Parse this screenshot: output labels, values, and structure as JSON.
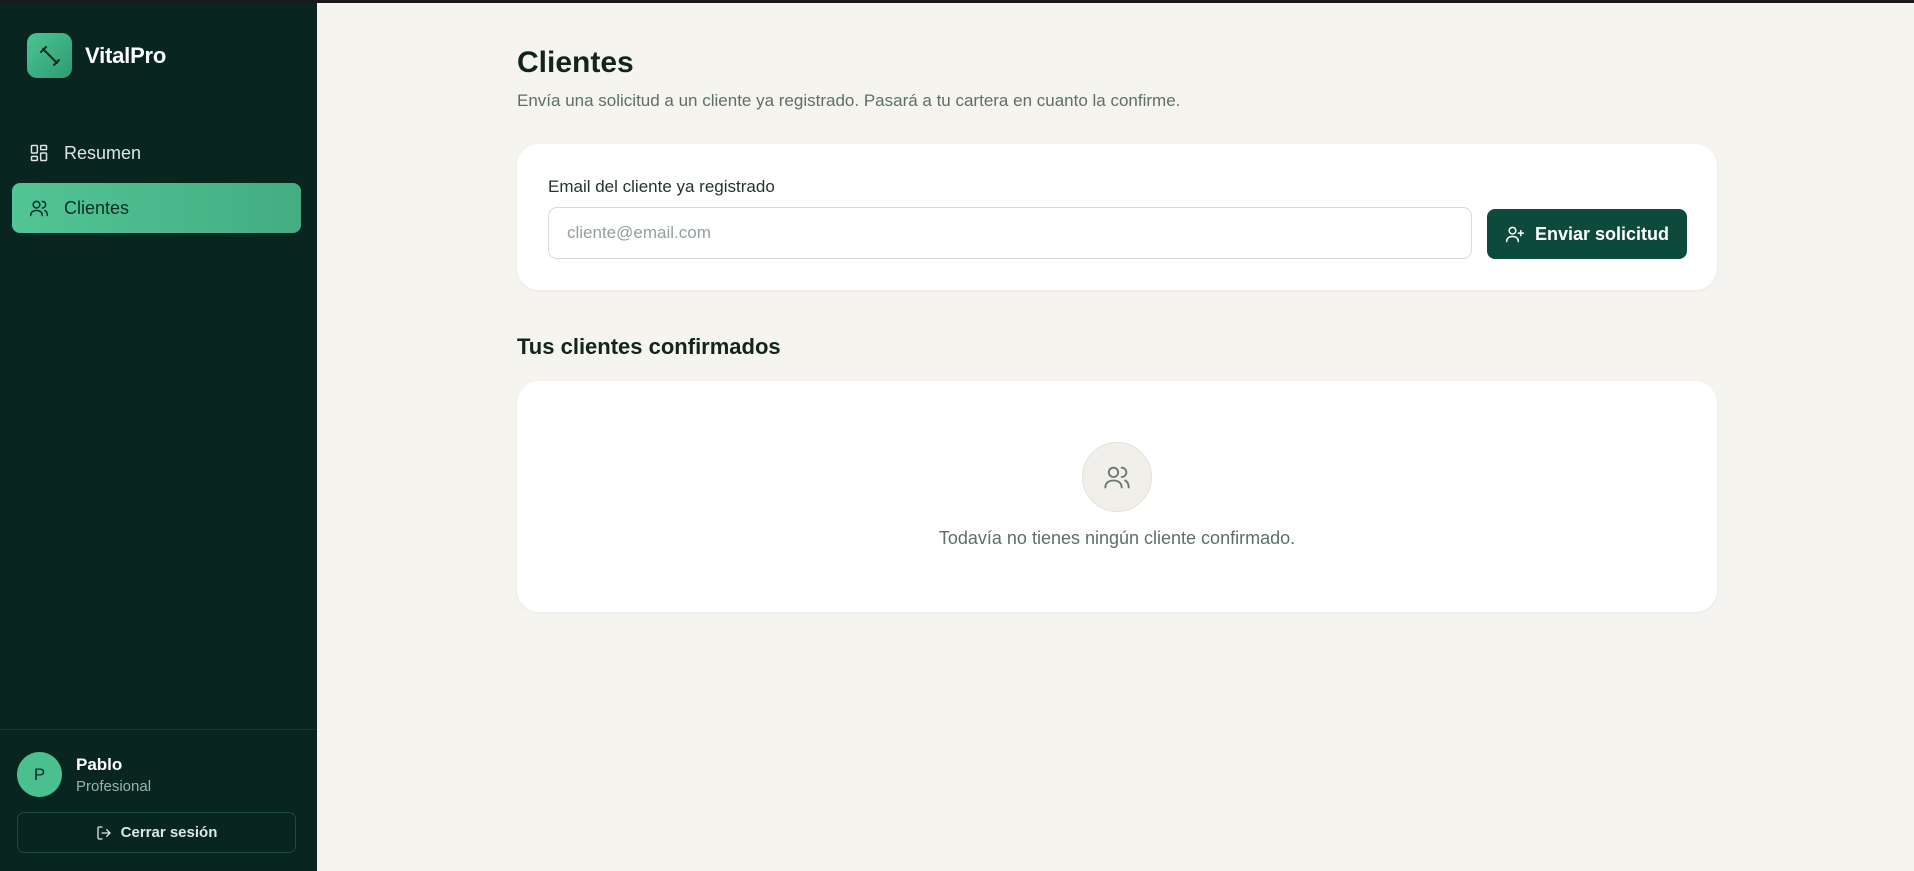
{
  "app": {
    "name": "VitalPro"
  },
  "sidebar": {
    "items": [
      {
        "label": "Resumen",
        "icon": "dashboard-icon",
        "active": false
      },
      {
        "label": "Clientes",
        "icon": "users-icon",
        "active": true
      }
    ],
    "user": {
      "initial": "P",
      "name": "Pablo",
      "role": "Profesional"
    },
    "logout_label": "Cerrar sesión"
  },
  "page": {
    "title": "Clientes",
    "subtitle": "Envía una solicitud a un cliente ya registrado. Pasará a tu cartera en cuanto la confirme."
  },
  "form": {
    "label": "Email del cliente ya registrado",
    "value": "",
    "placeholder": "cliente@email.com",
    "button_label": "Enviar solicitud"
  },
  "confirmed": {
    "title": "Tus clientes confirmados",
    "empty_message": "Todavía no tienes ningún cliente confirmado."
  },
  "colors": {
    "sidebar_bg": "#082520",
    "accent": "#4cc493",
    "primary_button": "#0e4a3b",
    "page_bg": "#f5f4ef"
  }
}
